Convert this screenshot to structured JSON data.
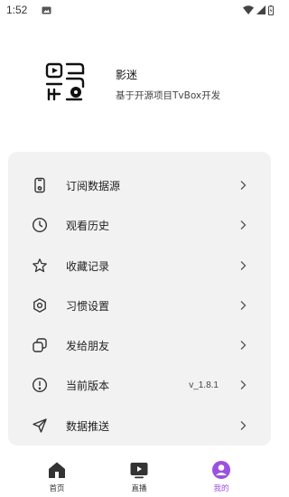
{
  "status_bar": {
    "time": "1:52"
  },
  "profile": {
    "app_name": "影迷",
    "description": "基于开源项目TvBox开发"
  },
  "menu": [
    {
      "label": "订阅数据源",
      "icon": "phone-sync-icon"
    },
    {
      "label": "观看历史",
      "icon": "clock-icon"
    },
    {
      "label": "收藏记录",
      "icon": "star-icon"
    },
    {
      "label": "习惯设置",
      "icon": "hexagon-settings-icon"
    },
    {
      "label": "发给朋友",
      "icon": "share-copy-icon"
    },
    {
      "label": "当前版本",
      "icon": "info-icon",
      "value": "v_1.8.1"
    },
    {
      "label": "数据推送",
      "icon": "send-icon"
    }
  ],
  "tabs": [
    {
      "label": "首页",
      "icon": "home-icon",
      "active": false
    },
    {
      "label": "直播",
      "icon": "live-tv-icon",
      "active": false
    },
    {
      "label": "我的",
      "icon": "profile-icon",
      "active": true
    }
  ],
  "colors": {
    "accent": "#9b51e0",
    "card_bg": "#f2f2f2",
    "text": "#222222"
  }
}
